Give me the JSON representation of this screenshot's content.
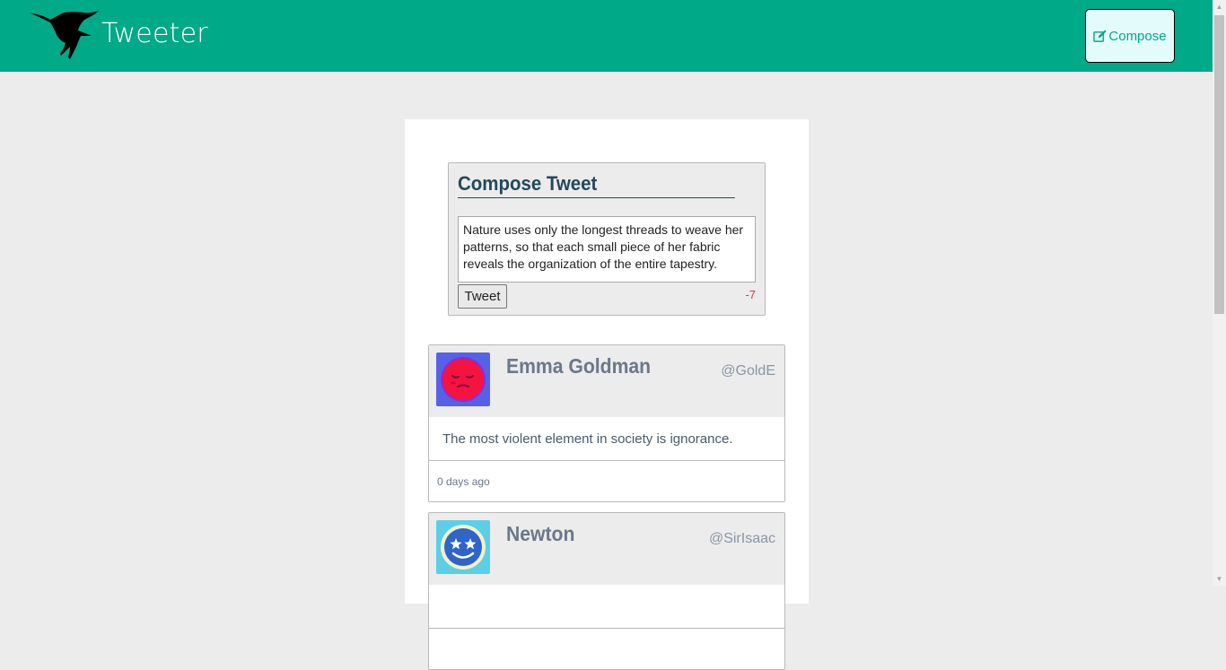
{
  "header": {
    "brand": "Tweeter",
    "logo_icon": "hummingbird-icon",
    "compose_label": "Compose",
    "compose_icon": "edit-icon",
    "background_color": "#00a987"
  },
  "compose": {
    "title": "Compose Tweet",
    "text": "Nature uses only the longest threads to weave her patterns, so that each small piece of her fabric reveals the organization of the entire tapestry.",
    "button_label": "Tweet",
    "counter": "-7",
    "counter_color": "#dc3545"
  },
  "tweets": [
    {
      "name": "Emma Goldman",
      "handle": "@GoldE",
      "avatar_icon": "sleepy-face-avatar-icon",
      "content": "The most violent element in society is ignorance.",
      "time": "0 days ago"
    },
    {
      "name": "Newton",
      "handle": "@SirIsaac",
      "avatar_icon": "star-eyes-face-avatar-icon",
      "content": "",
      "time": ""
    }
  ]
}
